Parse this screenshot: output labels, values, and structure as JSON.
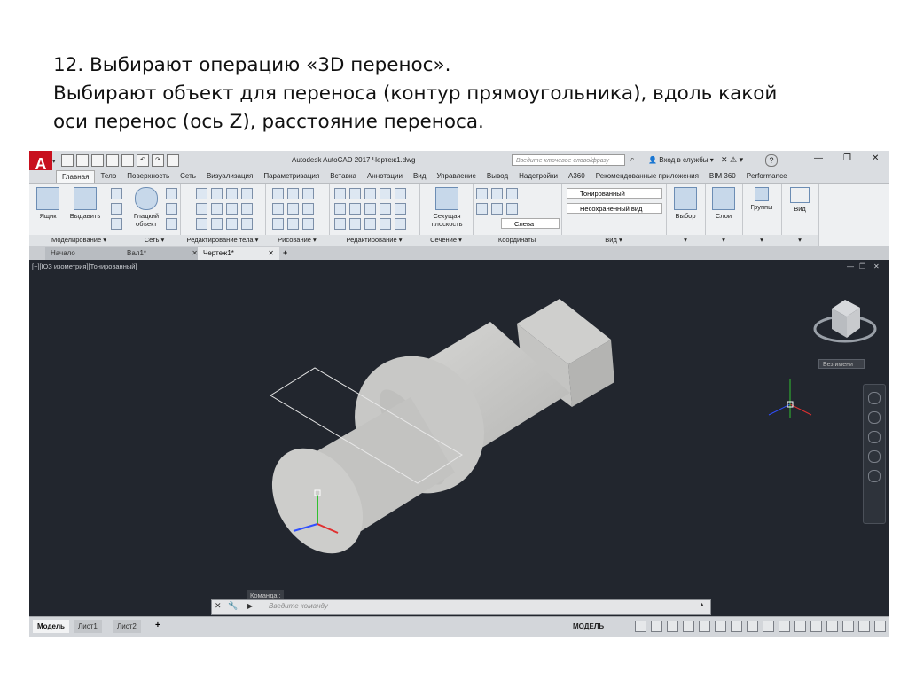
{
  "slide": {
    "line1": "12. Выбирают операцию «3D перенос».",
    "line2": "Выбирают объект для переноса (контур прямоугольника), вдоль какой",
    "line3": "оси перенос (ось Z), расстояние переноса."
  },
  "titlebar": {
    "app_title": "Autodesk AutoCAD 2017    Чертеж1.dwg",
    "search_placeholder": "Введите ключевое слово/фразу",
    "sign_in": "Вход в службы"
  },
  "ribbon_tabs": [
    "Главная",
    "Тело",
    "Поверхность",
    "Сеть",
    "Визуализация",
    "Параметризация",
    "Вставка",
    "Аннотации",
    "Вид",
    "Управление",
    "Вывод",
    "Надстройки",
    "A360",
    "Рекомендованные приложения",
    "BIM 360",
    "Performance"
  ],
  "ribbon": {
    "box": "Ящик",
    "extrude": "Выдавить",
    "smooth_object_1": "Гладкий",
    "smooth_object_2": "объект",
    "section_plane_1": "Секущая",
    "section_plane_2": "плоскость",
    "visual_style": "Тонированный",
    "saved_view": "Несохраненный вид",
    "view_direction": "Слева",
    "selection": "Выбор",
    "layers": "Слои",
    "groups": "Группы",
    "view": "Вид",
    "panels": {
      "modeling": "Моделирование",
      "mesh": "Сеть",
      "solid_editing": "Редактирование тела",
      "draw": "Рисование",
      "modify": "Редактирование",
      "section": "Сечение",
      "coordinates": "Координаты",
      "view": "Вид"
    }
  },
  "doc_tabs": [
    "Начало",
    "Вал1*",
    "Чертеж1*"
  ],
  "viewport": {
    "label": "[−][ЮЗ изометрия][Тонированный]",
    "named_ucs": "Без имени"
  },
  "command": {
    "label": "Команда :",
    "placeholder": "Введите команду"
  },
  "layout_tabs": [
    "Модель",
    "Лист1",
    "Лист2"
  ],
  "status": {
    "model": "МОДЕЛЬ"
  },
  "colors": {
    "viewport_bg": "#22262e",
    "ribbon_bg": "#eef0f2",
    "logo_red": "#c8101e",
    "axis_x": "#e03030",
    "axis_y": "#30c030",
    "axis_z": "#3050ff"
  }
}
